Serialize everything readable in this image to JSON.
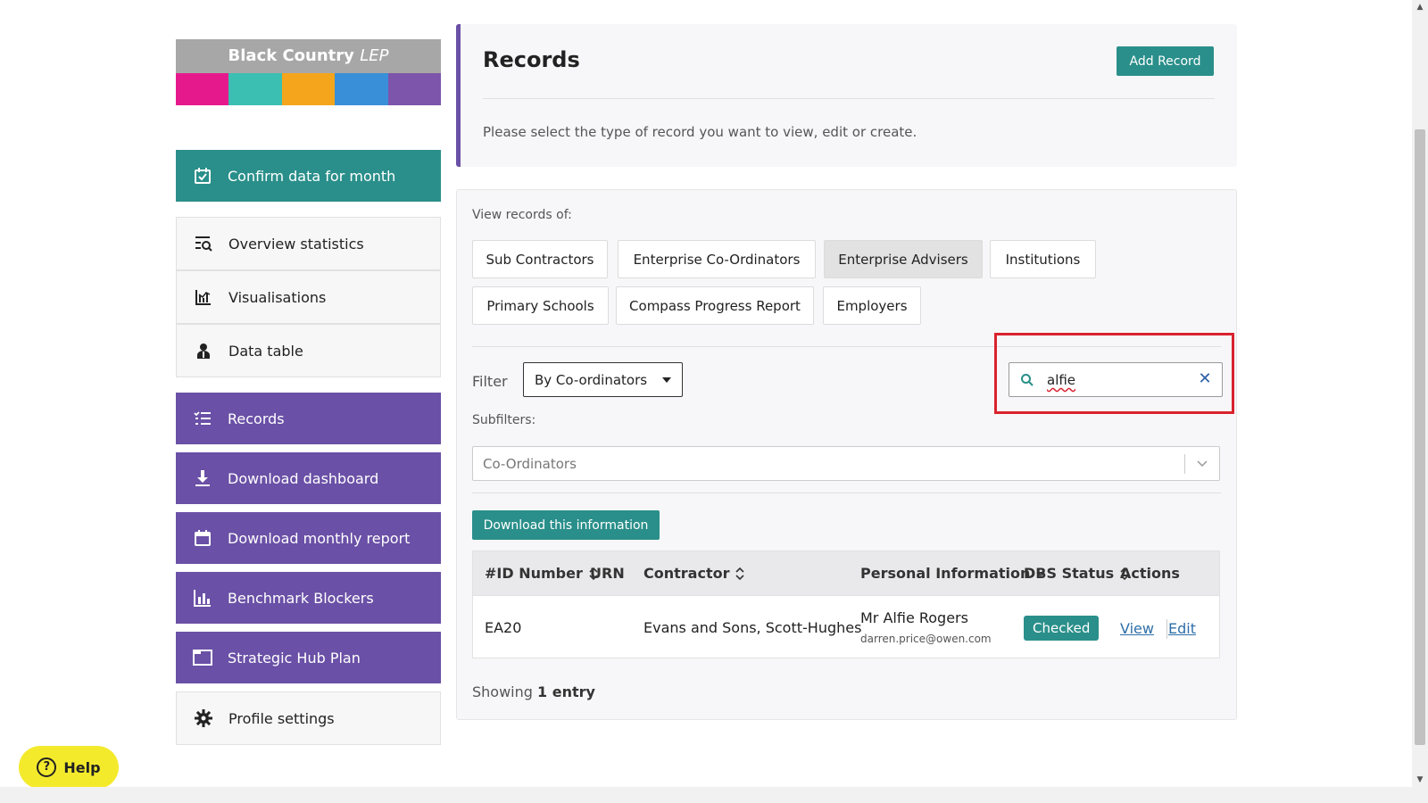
{
  "logo": {
    "name": "Black Country",
    "suffix": "LEP",
    "stripe_colors": [
      "#e6198c",
      "#3bbfb2",
      "#f4a51c",
      "#3a8fd9",
      "#7d55ab"
    ]
  },
  "sidebar": {
    "items": [
      {
        "label": "Confirm data for month",
        "icon": "calendar-check-icon",
        "style": "teal"
      },
      {
        "label": "Overview statistics",
        "icon": "search-list-icon",
        "style": "white"
      },
      {
        "label": "Visualisations",
        "icon": "chart-icon",
        "style": "white"
      },
      {
        "label": "Data table",
        "icon": "user-icon",
        "style": "white"
      },
      {
        "label": "Records",
        "icon": "list-icon",
        "style": "purple"
      },
      {
        "label": "Download dashboard",
        "icon": "download-icon",
        "style": "purple"
      },
      {
        "label": "Download monthly report",
        "icon": "calendar-icon",
        "style": "purple"
      },
      {
        "label": "Benchmark Blockers",
        "icon": "bar-chart-icon",
        "style": "purple"
      },
      {
        "label": "Strategic Hub Plan",
        "icon": "folder-icon",
        "style": "purple"
      },
      {
        "label": "Profile settings",
        "icon": "gear-icon",
        "style": "white"
      }
    ]
  },
  "header": {
    "title": "Records",
    "add_button": "Add Record",
    "description": "Please select the type of record you want to view, edit or create."
  },
  "records": {
    "view_label": "View records of:",
    "tabs": [
      {
        "label": "Sub Contractors",
        "active": false
      },
      {
        "label": "Enterprise Co-Ordinators",
        "active": false
      },
      {
        "label": "Enterprise Advisers",
        "active": true
      },
      {
        "label": "Institutions",
        "active": false
      },
      {
        "label": "Primary Schools",
        "active": false
      },
      {
        "label": "Compass Progress Report",
        "active": false
      },
      {
        "label": "Employers",
        "active": false
      }
    ],
    "filter_label": "Filter",
    "filter_value": "By Co-ordinators",
    "search_value": "alfie",
    "subfilters_label": "Subfilters:",
    "subfilter_value": "Co-Ordinators",
    "download_button": "Download this information",
    "columns": [
      "#ID Number",
      "URN",
      "Contractor",
      "Personal Information",
      "DBS Status",
      "Actions"
    ],
    "rows": [
      {
        "id": "EA20",
        "contractor": "Evans and Sons, Scott-Hughes",
        "name": "Mr Alfie Rogers",
        "email": "darren.price@owen.com",
        "dbs_status": "Checked",
        "view": "View",
        "edit": "Edit"
      }
    ],
    "showing_prefix": "Showing",
    "showing_count": "1 entry"
  },
  "help": {
    "label": "Help"
  },
  "colors": {
    "teal": "#2a8f8a",
    "purple": "#6a50a6",
    "highlight": "#d9232e",
    "help": "#f4ea2c"
  }
}
